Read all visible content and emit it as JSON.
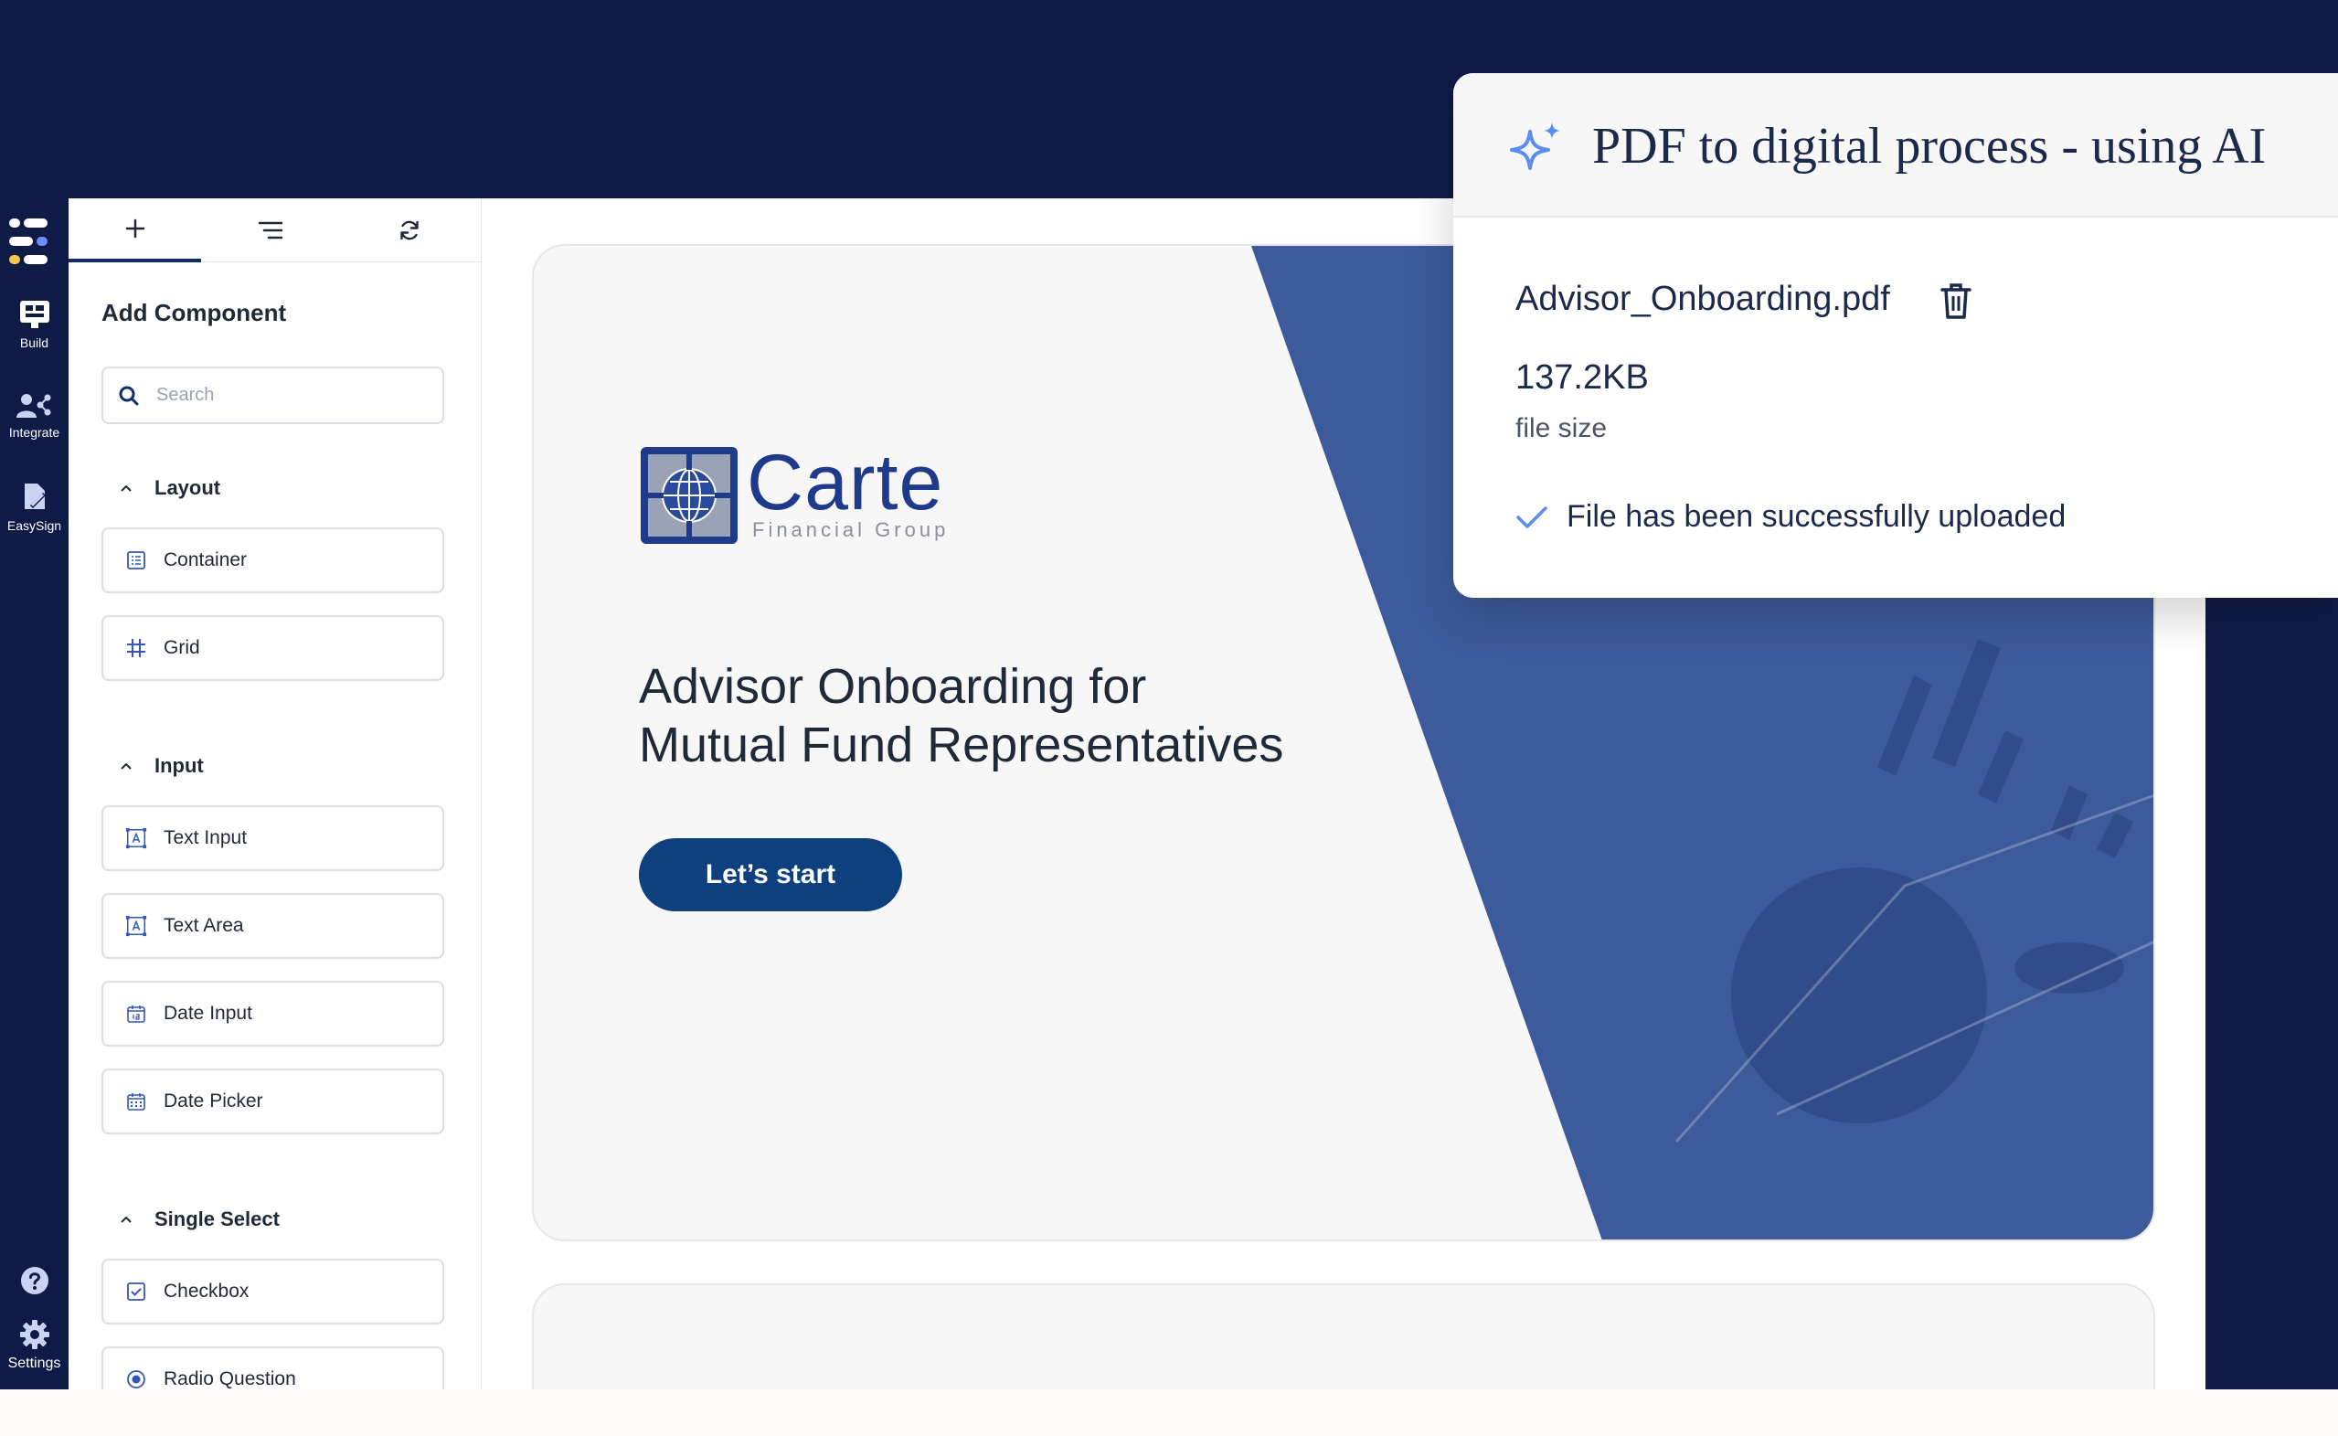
{
  "rail": {
    "items": [
      {
        "label": "Build",
        "icon": "build-icon"
      },
      {
        "label": "Integrate",
        "icon": "integrate-icon"
      },
      {
        "label": "EasySign",
        "icon": "easysign-icon"
      }
    ],
    "settings_label": "Settings"
  },
  "panel": {
    "tabs": [
      "add-tab",
      "outline-tab",
      "refresh-tab"
    ],
    "title": "Add Component",
    "search_placeholder": "Search",
    "sections": [
      {
        "title": "Layout",
        "items": [
          "Container",
          "Grid"
        ]
      },
      {
        "title": "Input",
        "items": [
          "Text Input",
          "Text Area",
          "Date Input",
          "Date Picker"
        ]
      },
      {
        "title": "Single Select",
        "items": [
          "Checkbox",
          "Radio Question"
        ]
      }
    ]
  },
  "card": {
    "brand_name": "Carte",
    "brand_sub": "Financial Group",
    "headline_line1": "Advisor Onboarding for",
    "headline_line2": "Mutual Fund Representatives",
    "cta_label": "Let’s start"
  },
  "popup": {
    "title": "PDF to digital process - using AI",
    "file_name": "Advisor_Onboarding.pdf",
    "file_size": "137.2KB",
    "file_size_label": "file size",
    "status": "File has been successfully uploaded"
  },
  "colors": {
    "navy": "#0f1b47",
    "cta": "#0e3f7e",
    "hero_blue": "#3d5a9a",
    "accent": "#5b8cf0"
  }
}
